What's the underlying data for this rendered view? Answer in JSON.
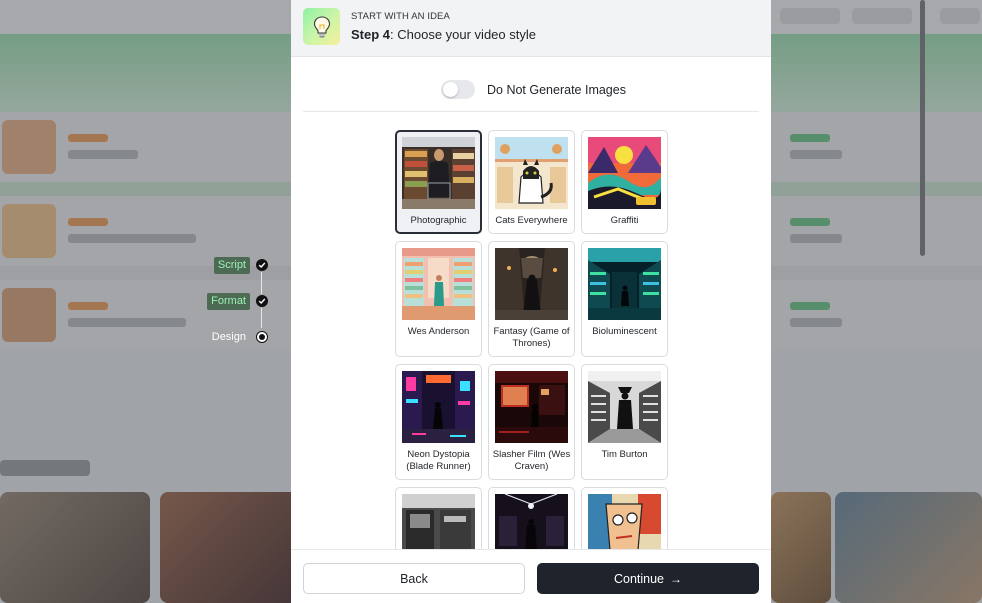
{
  "header": {
    "kicker": "START WITH AN IDEA",
    "step_prefix": "Step 4",
    "step_title": ": Choose your video style",
    "icon": "lightbulb-icon"
  },
  "toggle": {
    "label": "Do Not Generate Images",
    "on": false
  },
  "stepper": {
    "steps": [
      {
        "label": "Script",
        "status": "done"
      },
      {
        "label": "Format",
        "status": "done"
      },
      {
        "label": "Design",
        "status": "current"
      }
    ]
  },
  "styles": [
    {
      "name": "Photographic",
      "selected": true
    },
    {
      "name": "Cats Everywhere",
      "selected": false
    },
    {
      "name": "Graffiti",
      "selected": false
    },
    {
      "name": "Wes Anderson",
      "selected": false
    },
    {
      "name": "Fantasy (Game of Thrones)",
      "selected": false
    },
    {
      "name": "Bioluminescent",
      "selected": false
    },
    {
      "name": "Neon Dystopia (Blade Runner)",
      "selected": false
    },
    {
      "name": "Slasher Film (Wes Craven)",
      "selected": false
    },
    {
      "name": "Tim Burton",
      "selected": false
    },
    {
      "name": "",
      "selected": false
    },
    {
      "name": "",
      "selected": false
    },
    {
      "name": "",
      "selected": false
    }
  ],
  "footer": {
    "back_label": "Back",
    "continue_label": "Continue"
  },
  "colors": {
    "primary_button": "#1f242c",
    "accent_green": "#9cf0b4"
  }
}
